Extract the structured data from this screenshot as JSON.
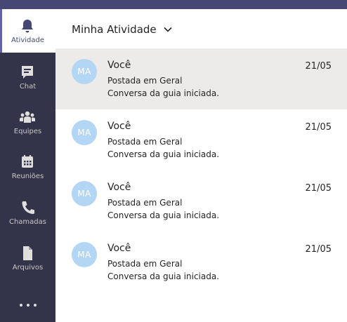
{
  "rail": {
    "items": [
      {
        "label": "Atividade",
        "icon": "bell-icon",
        "active": true
      },
      {
        "label": "Chat",
        "icon": "chat-icon",
        "active": false
      },
      {
        "label": "Equipes",
        "icon": "teams-icon",
        "active": false
      },
      {
        "label": "Reuniões",
        "icon": "calendar-icon",
        "active": false
      },
      {
        "label": "Chamadas",
        "icon": "phone-icon",
        "active": false
      },
      {
        "label": "Arquivos",
        "icon": "file-icon",
        "active": false
      }
    ],
    "more_icon": "more-icon"
  },
  "header": {
    "title": "Minha Atividade",
    "dropdown_icon": "chevron-down-icon"
  },
  "feed": {
    "items": [
      {
        "initials": "MA",
        "author": "Você",
        "date": "21/05",
        "line1": "Postada em Geral",
        "line2": "Conversa da guia iniciada.",
        "selected": true
      },
      {
        "initials": "MA",
        "author": "Você",
        "date": "21/05",
        "line1": "Postada em Geral",
        "line2": "Conversa da guia iniciada.",
        "selected": false
      },
      {
        "initials": "MA",
        "author": "Você",
        "date": "21/05",
        "line1": "Postada em Geral",
        "line2": "Conversa da guia iniciada.",
        "selected": false
      },
      {
        "initials": "MA",
        "author": "Você",
        "date": "21/05",
        "line1": "Postada em Geral",
        "line2": "Conversa da guia iniciada.",
        "selected": false
      }
    ]
  },
  "colors": {
    "rail_bg": "#33344a",
    "topbar": "#464775",
    "accent": "#6264a7",
    "selected_row": "#edebe9",
    "avatar_bg": "#b4d6f5"
  }
}
